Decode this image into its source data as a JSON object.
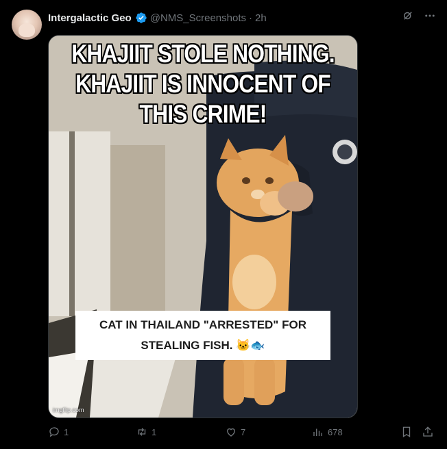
{
  "tweet": {
    "display_name": "Intergalactic Geo",
    "handle": "@NMS_Screenshots",
    "separator": "·",
    "time": "2h"
  },
  "media": {
    "meme_text": "KHAJIIT STOLE NOTHING. KHAJIIT IS INNOCENT OF THIS CRIME!",
    "caption_line1": "CAT IN THAILAND \"ARRESTED\" FOR",
    "caption_line2": "STEALING FISH. 🐱🐟",
    "watermark": "imgflip.com"
  },
  "actions": {
    "replies": "1",
    "reposts": "1",
    "likes": "7",
    "views": "678"
  },
  "colors": {
    "background": "#000000",
    "text_primary": "#e7e9ea",
    "text_secondary": "#71767b",
    "verified_blue": "#1d9bf0"
  }
}
